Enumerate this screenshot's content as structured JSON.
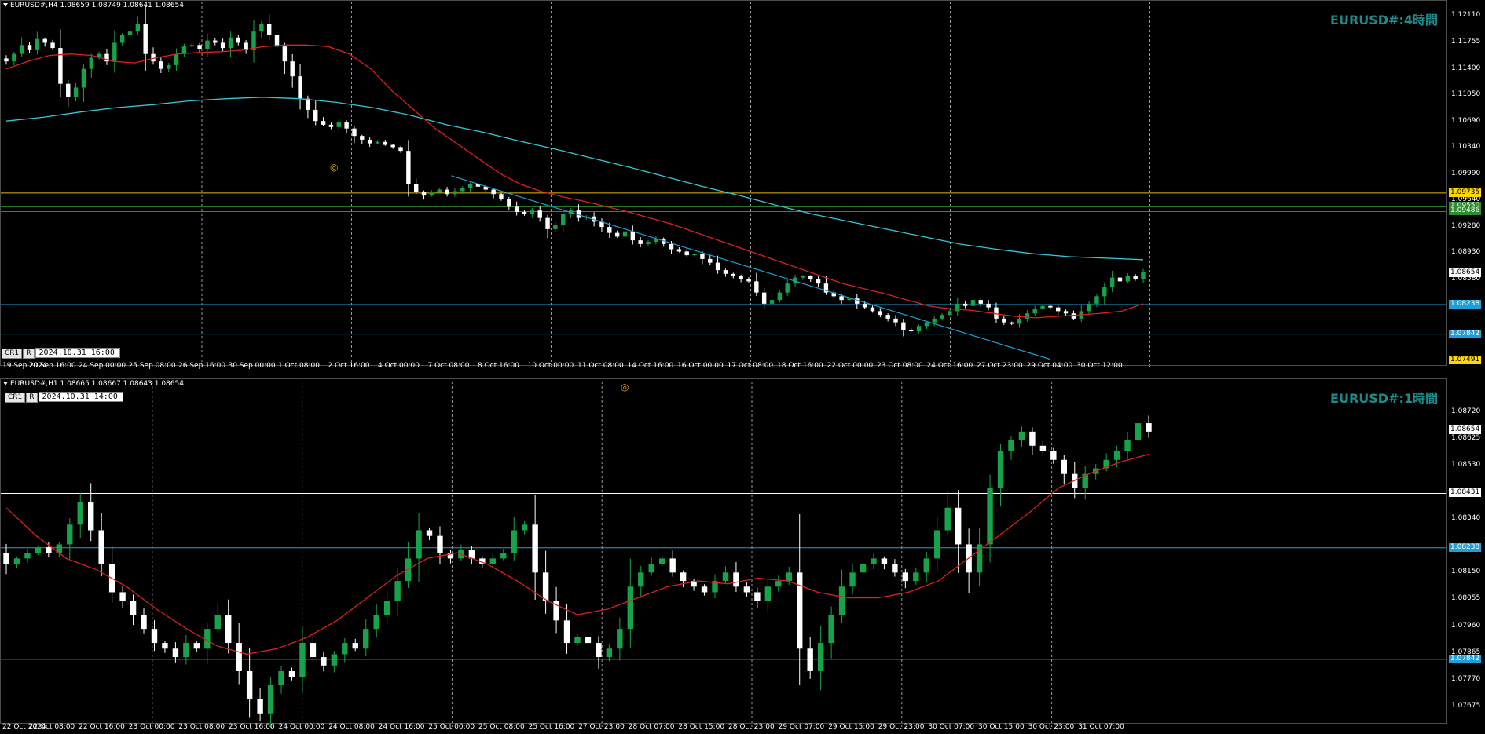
{
  "panes": {
    "top": {
      "header": "EURUSD#,H4  1.08659 1.08749 1.08641 1.08654",
      "symbol_label": "EURUSD#:4時間",
      "ctrl_buttons": [
        "CR1",
        "R"
      ],
      "datetime": "2024.10.31 16:00",
      "eye_icon": "eye-icon",
      "hlines": [
        {
          "price": 1.0955,
          "color": "#2e8b2e",
          "tag": "1.09550",
          "tag_bg": "#2e8b2e",
          "tag_fg": "#ffffff"
        },
        {
          "price": 1.09735,
          "color": "#e2c000",
          "tag": "1.09735",
          "tag_bg": "#ffd700",
          "tag_fg": "#000000"
        },
        {
          "price": 1.09486,
          "color": "#2e8b2e",
          "tag": "1.09486",
          "tag_bg": "#2e8b2e",
          "tag_fg": "#ffffff"
        },
        {
          "price": 1.08238,
          "color": "#1e9fd8",
          "tag": "1.08238",
          "tag_bg": "#1e9fd8",
          "tag_fg": "#ffffff"
        },
        {
          "price": 1.07842,
          "color": "#1e9fd8",
          "tag": "1.07842",
          "tag_bg": "#1e9fd8",
          "tag_fg": "#ffffff"
        }
      ],
      "extra_tags": [
        {
          "price": 1.08654,
          "tag": "1.08654",
          "tag_bg": "#ffffff",
          "tag_fg": "#000000"
        },
        {
          "price": 1.07491,
          "tag": "1.07491",
          "tag_bg": "#ffd700",
          "tag_fg": "#000000"
        }
      ]
    },
    "bottom": {
      "header": "EURUSD#,H1  1.08665 1.08667 1.08643 1.08654",
      "symbol_label": "EURUSD#:1時間",
      "ctrl_buttons": [
        "CR1",
        "R"
      ],
      "datetime": "2024.10.31 14:00",
      "eye_icon": "eye-icon",
      "hlines": [
        {
          "price": 1.08431,
          "color": "#ffffff",
          "tag": "1.08431",
          "tag_bg": "#ffffff",
          "tag_fg": "#000000"
        },
        {
          "price": 1.08238,
          "color": "#1e9fd8",
          "tag": "1.08238",
          "tag_bg": "#1e9fd8",
          "tag_fg": "#ffffff"
        },
        {
          "price": 1.07842,
          "color": "#1e9fd8",
          "tag": "1.07842",
          "tag_bg": "#1e9fd8",
          "tag_fg": "#ffffff"
        }
      ],
      "extra_tags": [
        {
          "price": 1.08654,
          "tag": "1.08654",
          "tag_bg": "#ffffff",
          "tag_fg": "#000000"
        }
      ]
    }
  },
  "chart_data": [
    {
      "type": "candlestick",
      "timeframe": "H4",
      "ylim": [
        1.0748,
        1.1226
      ],
      "yticks": [
        "1.12110",
        "1.11755",
        "1.11400",
        "1.11050",
        "1.10690",
        "1.10340",
        "1.09990",
        "1.09640",
        "1.09280",
        "1.08930",
        "1.08580"
      ],
      "yticks_values": [
        1.1211,
        1.11755,
        1.114,
        1.1105,
        1.1069,
        1.1034,
        1.0999,
        1.0964,
        1.0928,
        1.0893,
        1.0858
      ],
      "xticks": [
        "19 Sep 2024",
        "20 Sep 16:00",
        "24 Sep 00:00",
        "25 Sep 08:00",
        "26 Sep 16:00",
        "30 Sep 00:00",
        "1 Oct 08:00",
        "2 Oct 16:00",
        "4 Oct 00:00",
        "7 Oct 08:00",
        "8 Oct 16:00",
        "10 Oct 00:00",
        "11 Oct 08:00",
        "14 Oct 16:00",
        "16 Oct 00:00",
        "17 Oct 08:00",
        "18 Oct 16:00",
        "22 Oct 00:00",
        "23 Oct 08:00",
        "24 Oct 16:00",
        "27 Oct 23:00",
        "29 Oct 04:00",
        "30 Oct 12:00"
      ],
      "close_path": [
        1.115,
        1.116,
        1.1172,
        1.1165,
        1.118,
        1.1175,
        1.1168,
        1.112,
        1.1102,
        1.1115,
        1.114,
        1.1155,
        1.116,
        1.115,
        1.1175,
        1.1185,
        1.119,
        1.12,
        1.116,
        1.115,
        1.114,
        1.1145,
        1.116,
        1.117,
        1.1172,
        1.1166,
        1.1178,
        1.1175,
        1.1168,
        1.1182,
        1.1175,
        1.1165,
        1.119,
        1.12,
        1.1185,
        1.117,
        1.115,
        1.113,
        1.11,
        1.1085,
        1.107,
        1.1065,
        1.1062,
        1.1068,
        1.106,
        1.105,
        1.1045,
        1.104,
        1.1042,
        1.1038,
        1.1035,
        1.103,
        1.0985,
        1.0975,
        1.097,
        1.0974,
        1.0978,
        1.0972,
        1.0976,
        1.098,
        1.0985,
        1.0982,
        1.0978,
        1.0972,
        1.0965,
        1.0955,
        1.0948,
        1.0945,
        1.095,
        1.094,
        1.0925,
        1.093,
        1.0945,
        1.095,
        1.094,
        1.0942,
        1.0935,
        1.0928,
        1.092,
        1.0915,
        1.0922,
        1.091,
        1.0905,
        1.0908,
        1.0912,
        1.0905,
        1.0898,
        1.0895,
        1.089,
        1.0892,
        1.0885,
        1.088,
        1.087,
        1.0865,
        1.0862,
        1.0858,
        1.0855,
        1.084,
        1.0825,
        1.083,
        1.084,
        1.0852,
        1.086,
        1.0862,
        1.0858,
        1.0852,
        1.084,
        1.0835,
        1.083,
        1.0832,
        1.0825,
        1.082,
        1.0815,
        1.081,
        1.0805,
        1.08,
        1.079,
        1.0788,
        1.0795,
        1.08,
        1.0805,
        1.081,
        1.0815,
        1.0825,
        1.0822,
        1.083,
        1.0825,
        1.082,
        1.0805,
        1.08,
        1.0798,
        1.0805,
        1.0812,
        1.0818,
        1.0822,
        1.082,
        1.0815,
        1.0812,
        1.0805,
        1.0815,
        1.0825,
        1.0835,
        1.0848,
        1.086,
        1.0855,
        1.0862,
        1.0858,
        1.0868
      ],
      "ema_short_path": [
        1.114,
        1.115,
        1.1158,
        1.116,
        1.1158,
        1.115,
        1.1148,
        1.1155,
        1.116,
        1.1162,
        1.1163,
        1.1165,
        1.117,
        1.1172,
        1.1172,
        1.117,
        1.116,
        1.114,
        1.111,
        1.1085,
        1.106,
        1.104,
        1.102,
        1.1,
        1.0985,
        1.0975,
        1.0968,
        1.0962,
        1.0955,
        1.0948,
        1.094,
        1.0932,
        1.0922,
        1.0912,
        1.0902,
        1.0892,
        1.0882,
        1.0872,
        1.0862,
        1.0852,
        1.0845,
        1.0838,
        1.083,
        1.0822,
        1.0818,
        1.0816,
        1.0812,
        1.0808,
        1.0806,
        1.0808,
        1.081,
        1.0812,
        1.0815,
        1.0825
      ],
      "ema_long_path": [
        1.107,
        1.1075,
        1.1082,
        1.1088,
        1.1092,
        1.1097,
        1.11,
        1.1102,
        1.11,
        1.1095,
        1.1088,
        1.1078,
        1.1065,
        1.1055,
        1.1043,
        1.1032,
        1.102,
        1.1008,
        1.0995,
        1.0982,
        1.097,
        1.0957,
        1.0945,
        1.0935,
        1.0925,
        1.0915,
        1.0905,
        1.0898,
        1.0892,
        1.0888,
        1.0886,
        1.0884
      ],
      "trendline": {
        "start": {
          "x": "7 Oct 08:00",
          "y": 1.09965
        },
        "end": {
          "x": "29 Oct 04:00",
          "y": 1.07505
        },
        "color": "#1e9fd8"
      }
    },
    {
      "type": "candlestick",
      "timeframe": "H1",
      "ylim": [
        1.0763,
        1.088
      ],
      "yticks": [
        "1.08720",
        "1.08625",
        "1.08530",
        "1.08340",
        "1.08150",
        "1.08055",
        "1.07960",
        "1.07865",
        "1.07770",
        "1.07675"
      ],
      "yticks_values": [
        1.0872,
        1.08625,
        1.0853,
        1.0834,
        1.0815,
        1.08055,
        1.0796,
        1.07865,
        1.0777,
        1.07675
      ],
      "xticks": [
        "22 Oct 2024",
        "22 Oct 08:00",
        "22 Oct 16:00",
        "23 Oct 00:00",
        "23 Oct 08:00",
        "23 Oct 16:00",
        "24 Oct 00:00",
        "24 Oct 08:00",
        "24 Oct 16:00",
        "25 Oct 00:00",
        "25 Oct 08:00",
        "25 Oct 16:00",
        "27 Oct 23:00",
        "28 Oct 07:00",
        "28 Oct 15:00",
        "28 Oct 23:00",
        "29 Oct 07:00",
        "29 Oct 15:00",
        "29 Oct 23:00",
        "30 Oct 07:00",
        "30 Oct 15:00",
        "30 Oct 23:00",
        "31 Oct 07:00"
      ],
      "close_path": [
        1.0818,
        1.082,
        1.0822,
        1.0824,
        1.0822,
        1.0825,
        1.0832,
        1.084,
        1.083,
        1.0818,
        1.0808,
        1.0805,
        1.08,
        1.0795,
        1.079,
        1.0788,
        1.0785,
        1.079,
        1.0788,
        1.0795,
        1.08,
        1.079,
        1.078,
        1.077,
        1.0765,
        1.0775,
        1.078,
        1.0778,
        1.079,
        1.0785,
        1.0782,
        1.0786,
        1.079,
        1.0788,
        1.0795,
        1.08,
        1.0805,
        1.0812,
        1.082,
        1.083,
        1.0828,
        1.0822,
        1.082,
        1.0823,
        1.082,
        1.0818,
        1.082,
        1.0822,
        1.083,
        1.0832,
        1.0815,
        1.0805,
        1.0798,
        1.079,
        1.0792,
        1.079,
        1.0785,
        1.0788,
        1.0795,
        1.081,
        1.0815,
        1.0818,
        1.082,
        1.0815,
        1.0812,
        1.081,
        1.0808,
        1.0812,
        1.0815,
        1.081,
        1.0808,
        1.0805,
        1.081,
        1.0812,
        1.0815,
        1.0788,
        1.078,
        1.079,
        1.08,
        1.081,
        1.0815,
        1.0818,
        1.082,
        1.0818,
        1.0815,
        1.0812,
        1.0815,
        1.082,
        1.083,
        1.0838,
        1.0825,
        1.0815,
        1.0825,
        1.0845,
        1.0858,
        1.0862,
        1.0865,
        1.086,
        1.0858,
        1.0855,
        1.085,
        1.0845,
        1.085,
        1.0852,
        1.0855,
        1.0858,
        1.0862,
        1.0868,
        1.0865
      ],
      "ema_path": [
        1.0838,
        1.0828,
        1.082,
        1.0816,
        1.081,
        1.0802,
        1.0795,
        1.0789,
        1.0786,
        1.0788,
        1.0792,
        1.0798,
        1.0806,
        1.0814,
        1.082,
        1.0822,
        1.0818,
        1.0812,
        1.0805,
        1.08,
        1.0802,
        1.0806,
        1.081,
        1.0812,
        1.0811,
        1.0813,
        1.0812,
        1.0808,
        1.0806,
        1.0806,
        1.0808,
        1.0812,
        1.082,
        1.0828,
        1.0836,
        1.0845,
        1.085,
        1.0854,
        1.0857
      ]
    }
  ]
}
